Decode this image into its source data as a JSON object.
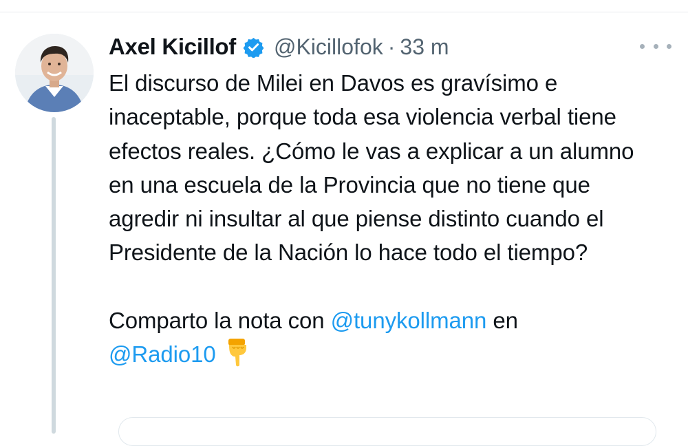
{
  "tweet": {
    "author_name": "Axel Kicillof",
    "handle": "@Kicillofok",
    "separator": "·",
    "time": "33 m",
    "verified_icon": "verified-badge-icon",
    "more_icon": "more-options-icon",
    "text_para1": "El discurso de Milei en Davos es gravísimo e inaceptable, porque toda esa violencia verbal tiene efectos reales. ¿Cómo le vas a explicar a un alumno en una escuela de la Provincia que no tiene que agredir ni insultar al que piense distinto cuando el Presidente de la Nación lo hace todo el tiempo?",
    "text_para2_prefix": "Comparto la nota con",
    "mention1": "@tunykollmann",
    "text_para2_mid": "en",
    "mention2": "@Radio10",
    "emoji": "pointing-down-hand-icon"
  },
  "colors": {
    "link": "#1d9bf0",
    "text": "#0f1419",
    "secondary": "#536471",
    "verified": "#1d9bf0",
    "thread_line": "#cfd9de"
  }
}
